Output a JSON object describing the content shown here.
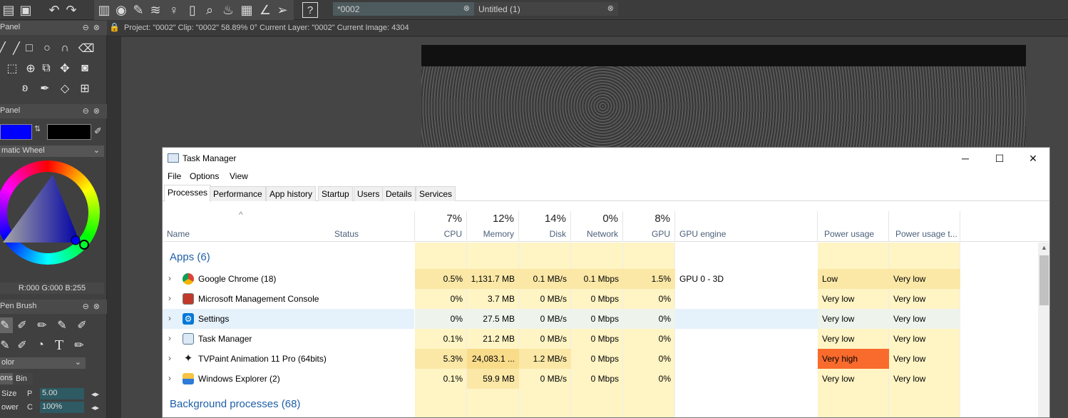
{
  "tvpaint": {
    "doc_tabs": [
      {
        "label": "*0002"
      },
      {
        "label": "Untitled (1)"
      }
    ],
    "status_line": "Project: \"0002\"  Clip: \"0002\"   58.89%   0°  Current Layer: \"0002\"  Current Image: 4304",
    "panels": {
      "tools_header": "Panel",
      "color_header": "Panel",
      "wheel_label": "matic Wheel",
      "rgb_readout": "R:000 G:000 B:255",
      "brush_header": "Pen Brush",
      "color_mode": "olor",
      "tabs": [
        "ons",
        "Bin"
      ],
      "size_label": "Size",
      "size_key": "P",
      "size_value": "5.00",
      "power_label": "ower",
      "power_key": "C",
      "power_value": "100%"
    },
    "colors": {
      "primary": "#0000ff",
      "secondary": "#000000"
    }
  },
  "taskmanager": {
    "title": "Task Manager",
    "menu": [
      "File",
      "Options",
      "View"
    ],
    "tabs": [
      "Processes",
      "Performance",
      "App history",
      "Startup",
      "Users",
      "Details",
      "Services"
    ],
    "columns": {
      "name": "Name",
      "status": "Status",
      "cpu": {
        "pct": "7%",
        "label": "CPU"
      },
      "memory": {
        "pct": "12%",
        "label": "Memory"
      },
      "disk": {
        "pct": "14%",
        "label": "Disk"
      },
      "network": {
        "pct": "0%",
        "label": "Network"
      },
      "gpu": {
        "pct": "8%",
        "label": "GPU"
      },
      "gpu_engine": "GPU engine",
      "power": "Power usage",
      "power_trend": "Power usage t..."
    },
    "apps_group": "Apps (6)",
    "bg_group": "Background processes (68)",
    "rows": [
      {
        "name": "Google Chrome (18)",
        "cpu": "0.5%",
        "mem": "1,131.7 MB",
        "disk": "0.1 MB/s",
        "net": "0.1 Mbps",
        "gpu": "1.5%",
        "engine": "GPU 0 - 3D",
        "power": "Low",
        "trend": "Very low"
      },
      {
        "name": "Microsoft Management Console",
        "cpu": "0%",
        "mem": "3.7 MB",
        "disk": "0 MB/s",
        "net": "0 Mbps",
        "gpu": "0%",
        "engine": "",
        "power": "Very low",
        "trend": "Very low"
      },
      {
        "name": "Settings",
        "cpu": "0%",
        "mem": "27.5 MB",
        "disk": "0 MB/s",
        "net": "0 Mbps",
        "gpu": "0%",
        "engine": "",
        "power": "Very low",
        "trend": "Very low"
      },
      {
        "name": "Task Manager",
        "cpu": "0.1%",
        "mem": "21.2 MB",
        "disk": "0 MB/s",
        "net": "0 Mbps",
        "gpu": "0%",
        "engine": "",
        "power": "Very low",
        "trend": "Very low"
      },
      {
        "name": "TVPaint Animation 11 Pro (64bits)",
        "cpu": "5.3%",
        "mem": "24,083.1 ...",
        "disk": "1.2 MB/s",
        "net": "0 Mbps",
        "gpu": "0%",
        "engine": "",
        "power": "Very high",
        "trend": "Very low"
      },
      {
        "name": "Windows Explorer (2)",
        "cpu": "0.1%",
        "mem": "59.9 MB",
        "disk": "0 MB/s",
        "net": "0 Mbps",
        "gpu": "0%",
        "engine": "",
        "power": "Very low",
        "trend": "Very low"
      }
    ],
    "heat_colors": {
      "light": "#fff4c4",
      "mid": "#fbe8a6",
      "very_high": "#f96b2d",
      "low": "#fbe8a6"
    }
  }
}
